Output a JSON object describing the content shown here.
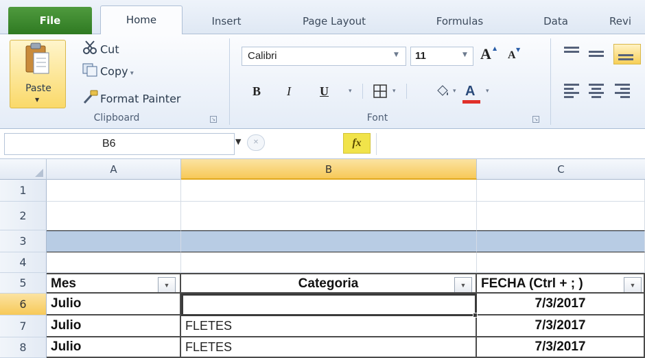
{
  "tabs": {
    "file": "File",
    "home": "Home",
    "insert": "Insert",
    "page_layout": "Page Layout",
    "formulas": "Formulas",
    "data": "Data",
    "review": "Revi"
  },
  "clipboard": {
    "paste": "Paste",
    "cut": "Cut",
    "copy": "Copy",
    "format_painter": "Format Painter",
    "group_label": "Clipboard"
  },
  "font": {
    "name": "Calibri",
    "size": "11",
    "group_label": "Font",
    "bold": "B",
    "italic": "I",
    "underline": "U",
    "grow": "A",
    "shrink": "A",
    "color_letter": "A"
  },
  "formula_bar": {
    "name_box": "B6",
    "fx": "fx",
    "formula": ""
  },
  "columns": [
    "A",
    "B",
    "C"
  ],
  "rows": [
    {
      "num": "1",
      "a": "",
      "b": "",
      "c": ""
    },
    {
      "num": "2",
      "a": "",
      "b": "",
      "c": ""
    },
    {
      "num": "3",
      "a": "",
      "b": "",
      "c": ""
    },
    {
      "num": "4",
      "a": "",
      "b": "",
      "c": ""
    },
    {
      "num": "5",
      "a": "Mes",
      "b": "Categoria",
      "c": "FECHA (Ctrl + ; )"
    },
    {
      "num": "6",
      "a": "Julio",
      "b": "",
      "c": "7/3/2017"
    },
    {
      "num": "7",
      "a": "Julio",
      "b": "FLETES",
      "c": "7/3/2017"
    },
    {
      "num": "8",
      "a": "Julio",
      "b": "FLETES",
      "c": "7/3/2017"
    }
  ],
  "colors": {
    "accent_file": "#2f7a22",
    "band": "#b8cce4",
    "selection_highlight": "#f7c958",
    "font_color_underline": "#e0302a"
  }
}
